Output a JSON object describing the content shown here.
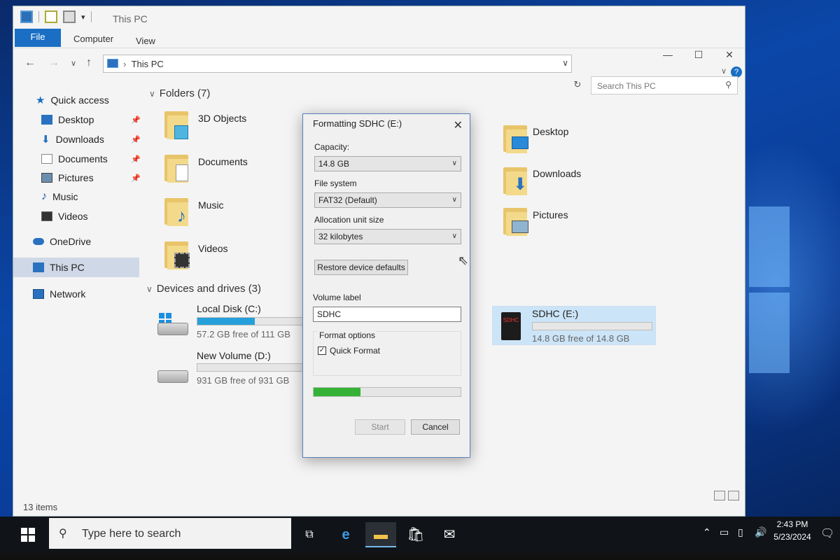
{
  "explorer": {
    "title": "This PC",
    "ribbon_tabs": [
      "File",
      "Computer",
      "View"
    ],
    "address_crumb": "This PC",
    "search_placeholder": "Search This PC",
    "status": "13 items"
  },
  "nav": {
    "quick_access": "Quick access",
    "items": [
      "Desktop",
      "Downloads",
      "Documents",
      "Pictures",
      "Music",
      "Videos"
    ],
    "onedrive": "OneDrive",
    "this_pc": "This PC",
    "network": "Network"
  },
  "folders": {
    "header": "Folders (7)",
    "list": [
      "3D Objects",
      "Documents",
      "Music",
      "Videos",
      "Desktop",
      "Downloads",
      "Pictures"
    ]
  },
  "drives": {
    "header": "Devices and drives (3)",
    "list": [
      {
        "name": "Local Disk (C:)",
        "free": "57.2 GB free of 111 GB",
        "used_fraction": 0.48
      },
      {
        "name": "New Volume (D:)",
        "free": "931 GB free of 931 GB",
        "used_fraction": 0.0
      },
      {
        "name": "SDHC (E:)",
        "free": "14.8 GB free of 14.8 GB",
        "used_fraction": 0.0
      }
    ],
    "sd_badge": "SDHC"
  },
  "dialog": {
    "title": "Formatting SDHC (E:)",
    "capacity_label": "Capacity:",
    "capacity_value": "14.8 GB",
    "fs_label": "File system",
    "fs_value": "FAT32 (Default)",
    "alloc_label": "Allocation unit size",
    "alloc_value": "32 kilobytes",
    "restore_button": "Restore device defaults",
    "volume_label": "Volume label",
    "volume_value": "SDHC",
    "format_options": "Format options",
    "quick_format": "Quick Format",
    "progress": 0.32,
    "start_button": "Start",
    "cancel_button": "Cancel"
  },
  "taskbar": {
    "search_placeholder": "Type here to search",
    "time": "2:43 PM",
    "date": "5/23/2024"
  }
}
